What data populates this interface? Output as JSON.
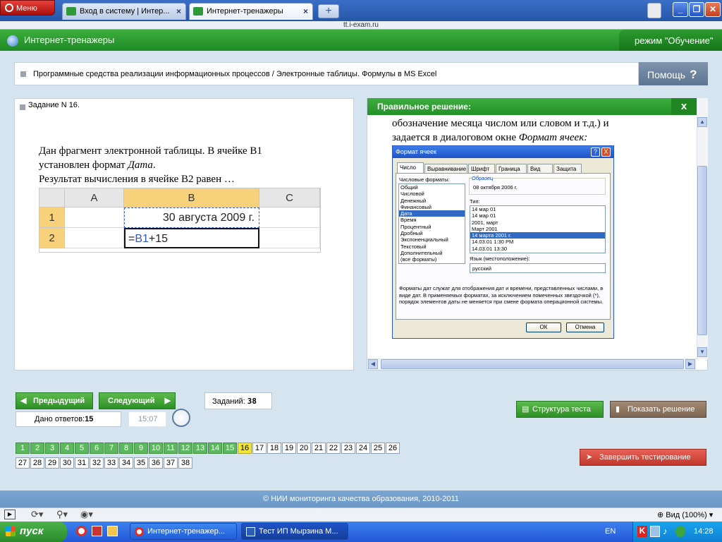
{
  "browser": {
    "menu_label": "Меню",
    "tabs": [
      {
        "label": "Вход в систему | Интер..."
      },
      {
        "label": "Интернет-тренажеры"
      }
    ],
    "new_tab_label": "+",
    "address": "tt.i-exam.ru",
    "window_buttons": {
      "minimize": "_",
      "restore": "❐",
      "close": "✕"
    }
  },
  "site": {
    "title": "Интернет-тренажеры",
    "mode": "режим \"Обучение\""
  },
  "breadcrumb": {
    "text": "Программные средства реализации информационных процессов / Электронные таблицы. Формулы в MS Excel",
    "help_label": "Помощь",
    "help_icon": "?"
  },
  "task": {
    "header": "Задание N 16.",
    "line1": "Дан фрагмент электронной таблицы. В ячейке B1",
    "line2_prefix": "установлен формат ",
    "line2_em": "Дата",
    "line2_suffix": ".",
    "line3": "Результат вычисления в ячейке B2 равен …",
    "sheet": {
      "col_a": "A",
      "col_b": "B",
      "col_c": "C",
      "row1": "1",
      "row2": "2",
      "b1": "30 августа 2009 г.",
      "b2_eq": "=",
      "b2_ref": "B1",
      "b2_rest": "+15"
    }
  },
  "solution": {
    "header": "Правильное решение:",
    "close": "x",
    "line1": "обозначение месяца числом или словом и т.д.) и",
    "line2_prefix": "задается в диалоговом окне ",
    "line2_em": "Формат  ячеек:",
    "dialog": {
      "title": "Формат ячеек",
      "help_btn": "?",
      "close_btn": "X",
      "tabs": [
        "Число",
        "Выравнивание",
        "Шрифт",
        "Граница",
        "Вид",
        "Защита"
      ],
      "formats_label": "Числовые форматы:",
      "formats": [
        "Общий",
        "Числовой",
        "Денежный",
        "Финансовый",
        "Дата",
        "Время",
        "Процентный",
        "Дробный",
        "Экспоненциальный",
        "Текстовый",
        "Дополнительный",
        "(все форматы)"
      ],
      "selected_format": 4,
      "sample_label": "Образец",
      "sample_value": "08 октября 2006 г.",
      "type_label": "Тип:",
      "types": [
        "14 мар 01",
        "14 мар 01",
        "2001, март",
        "Март 2001",
        "14 марта 2001 г.",
        "14.03.01 1:30 PM",
        "14.03.01 13:30"
      ],
      "selected_type": 4,
      "locale_label": "Язык (местоположение):",
      "locale_value": "русский",
      "description": "Форматы дат служат для отображения дат и времени, представленных числами, в виде дат. В применяемых форматах, за исключением помеченных звездочкой (*), порядок элементов даты не меняется при смене формата операционной системы.",
      "ok": "ОК",
      "cancel": "Отмена"
    }
  },
  "nav": {
    "prev": "Предыдущий",
    "next": "Следующий",
    "tasks_label": "Заданий:",
    "tasks_total": "38",
    "answers_label": "Дано ответов:",
    "answers_count": "15",
    "timer": "15:07",
    "structure_btn": "Структура теста",
    "show_solution_btn": "Показать решение",
    "finish_btn": "Завершить тестирование",
    "current": 16,
    "answered_through": 15,
    "numbers_row1": [
      "1",
      "2",
      "3",
      "4",
      "5",
      "6",
      "7",
      "8",
      "9",
      "10",
      "11",
      "12",
      "13",
      "14",
      "15",
      "16",
      "17",
      "18",
      "19",
      "20",
      "21",
      "22",
      "23",
      "24",
      "25",
      "26"
    ],
    "numbers_row2": [
      "27",
      "28",
      "29",
      "30",
      "31",
      "32",
      "33",
      "34",
      "35",
      "36",
      "37",
      "38"
    ]
  },
  "footer": "© НИИ мониторинга качества образования, 2010-2011",
  "statusbar": {
    "zoom": "Вид (100%)"
  },
  "taskbar": {
    "start": "пуск",
    "windows": [
      {
        "label": "Интернет-тренажер..."
      },
      {
        "label": "Тест ИП Мырзина М..."
      }
    ],
    "lang": "EN",
    "clock": "14:28"
  },
  "colors": {
    "site_green": "#2a9a2e",
    "current_task": "#f2e63a",
    "answered": "#5cb85c",
    "finish_red": "#d9483b"
  }
}
